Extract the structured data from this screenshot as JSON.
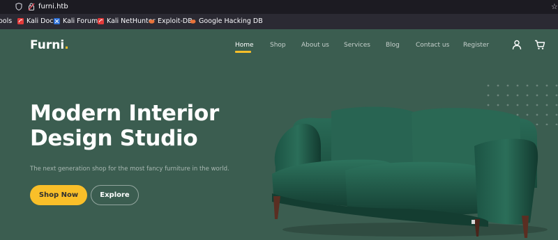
{
  "browser": {
    "url": "furni.htb",
    "bookmarks": [
      {
        "label": "ools",
        "icon": "folder-icon"
      },
      {
        "label": "Kali Docs",
        "icon": "kali-icon"
      },
      {
        "label": "Kali Forums",
        "icon": "kali-icon"
      },
      {
        "label": "Kali NetHunter",
        "icon": "kali-icon"
      },
      {
        "label": "Exploit-DB",
        "icon": "exploit-db-icon"
      },
      {
        "label": "Google Hacking DB",
        "icon": "exploit-db-icon"
      }
    ]
  },
  "site": {
    "logo_text": "Furni",
    "logo_dot": ".",
    "nav": [
      "Home",
      "Shop",
      "About us",
      "Services",
      "Blog",
      "Contact us",
      "Register"
    ],
    "active_nav": "Home"
  },
  "hero": {
    "title": "Modern Interior Design Studio",
    "subtitle": "The next generation shop for the most fancy furniture in the world.",
    "primary_button": "Shop Now",
    "secondary_button": "Explore"
  },
  "colors": {
    "background": "#3b5d50",
    "accent": "#f9bf29",
    "sofa": "#1f5a48"
  }
}
